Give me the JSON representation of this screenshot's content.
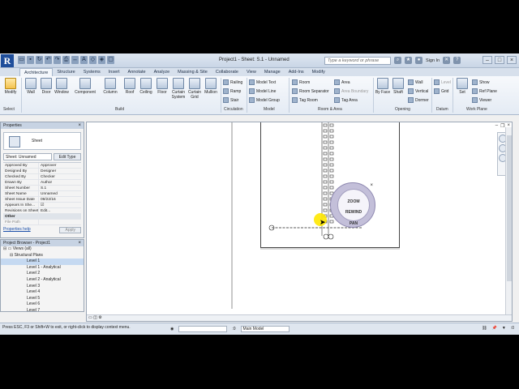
{
  "window": {
    "title": "Project1 - Sheet: S.1 - Unnamed",
    "search_placeholder": "Type a keyword or phrase",
    "sign_in": "Sign In"
  },
  "app_logo": "R",
  "tabs": [
    "Architecture",
    "Structure",
    "Systems",
    "Insert",
    "Annotate",
    "Analyze",
    "Massing & Site",
    "Collaborate",
    "View",
    "Manage",
    "Add-Ins",
    "Modify"
  ],
  "ribbon": {
    "big_buttons": [
      "Modify",
      "Wall",
      "Door",
      "Window",
      "Component",
      "Column",
      "Roof",
      "Ceiling",
      "Floor",
      "Curtain System",
      "Curtain Grid",
      "Mullion"
    ],
    "circulation": [
      "Railing",
      "Ramp",
      "Stair"
    ],
    "model": [
      "Model Text",
      "Model Line",
      "Model Group"
    ],
    "room_area": [
      "Room",
      "Room Separator",
      "Tag Room",
      "Area",
      "Area Boundary",
      "Tag Area"
    ],
    "opening": [
      "By Face",
      "Shaft",
      "Wall",
      "Vertical",
      "Dormer"
    ],
    "datum": [
      "Level",
      "Grid"
    ],
    "work_plane": [
      "Set",
      "Show",
      "Ref Plane",
      "Viewer"
    ],
    "groups": [
      "Select",
      "Build",
      "Circulation",
      "Model",
      "Room & Area",
      "Opening",
      "Datum",
      "Work Plane"
    ]
  },
  "properties": {
    "title": "Properties",
    "type_name": "Sheet",
    "filter": "Sheet: Unnamed",
    "edit_type": "Edit Type",
    "rows": [
      {
        "k": "Approved By",
        "v": "Approver"
      },
      {
        "k": "Designed By",
        "v": "Designer"
      },
      {
        "k": "Checked By",
        "v": "Checker"
      },
      {
        "k": "Drawn By",
        "v": "Author"
      },
      {
        "k": "Sheet Number",
        "v": "S.1"
      },
      {
        "k": "Sheet Name",
        "v": "Unnamed"
      },
      {
        "k": "Sheet Issue Date",
        "v": "09/22/16"
      },
      {
        "k": "Appears In She...",
        "v": "☑"
      },
      {
        "k": "Revisions on Sheet",
        "v": "Edit..."
      }
    ],
    "other_group": "Other",
    "file_path_label": "File Path",
    "help": "Properties help",
    "apply": "Apply"
  },
  "browser": {
    "title": "Project Browser - Project1",
    "items": [
      "Views (all)",
      "Structural Plans",
      "Level 1",
      "Level 1 - Analytical",
      "Level 2",
      "Level 2 - Analytical",
      "Level 3",
      "Level 4",
      "Level 5",
      "Level 6",
      "Level 7"
    ]
  },
  "wheel": {
    "zoom": "ZOOM",
    "rewind": "REWIND",
    "pan": "PAN"
  },
  "status": {
    "hint": "Press ESC, F3 or Shift+W to exit, or right-click to display context menu.",
    "scale": ":0",
    "model": "Main Model",
    "right_count": ":0"
  }
}
